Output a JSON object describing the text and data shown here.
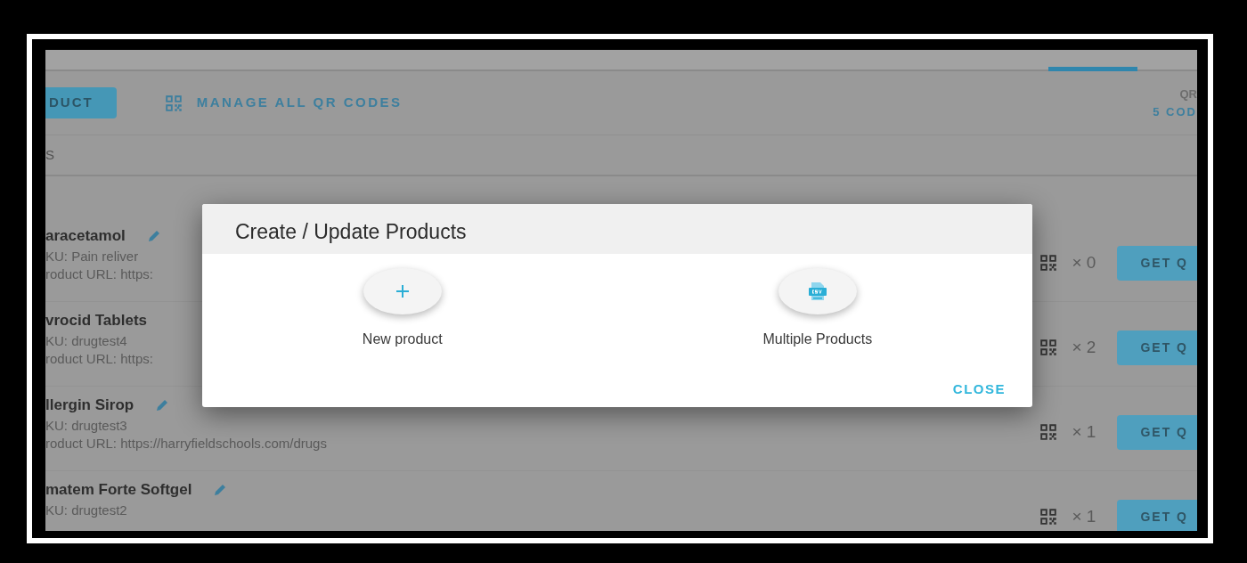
{
  "toolbar": {
    "primary_button": "DUCT",
    "link": "MANAGE ALL QR CODES",
    "summary_label": "QR",
    "summary_value": "5 COD"
  },
  "filter_text": "S",
  "products": [
    {
      "name": "aracetamol",
      "edit_icon": true,
      "sku": "KU: Pain reliver",
      "url": "roduct URL: https:",
      "qr_count": "× 0",
      "button": "GET Q"
    },
    {
      "name": "vrocid Tablets",
      "edit_icon": false,
      "sku": "KU: drugtest4",
      "url": "roduct URL: https:",
      "qr_count": "× 2",
      "button": "GET Q"
    },
    {
      "name": "llergin Sirop",
      "edit_icon": true,
      "sku": "KU: drugtest3",
      "url": "roduct URL: https://harryfieldschools.com/drugs",
      "qr_count": "× 1",
      "button": "GET Q"
    },
    {
      "name": "matem Forte Softgel",
      "edit_icon": true,
      "sku": "KU: drugtest2",
      "qr_count": "× 1",
      "button": "GET Q"
    }
  ],
  "dialog": {
    "title": "Create / Update Products",
    "options": [
      {
        "kind": "new",
        "label": "New product"
      },
      {
        "kind": "csv",
        "label": "Multiple Products"
      }
    ],
    "close": "CLOSE"
  }
}
